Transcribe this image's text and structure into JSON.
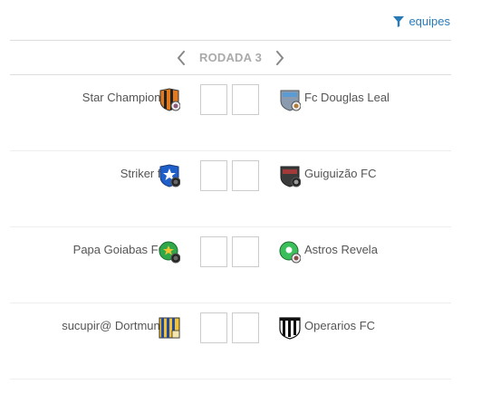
{
  "filter": {
    "label": "equipes",
    "icon": "filter-icon"
  },
  "round": {
    "title": "RODADA 3",
    "prev_icon": "chevron-left-icon",
    "next_icon": "chevron-right-icon"
  },
  "colors": {
    "link": "#2a7ab8",
    "muted": "#aaaaaa",
    "text": "#555555"
  },
  "matches": [
    {
      "home": {
        "name": "Star Champions",
        "crest": "orange-black-crest-icon"
      },
      "away": {
        "name": "Fc Douglas Leal",
        "crest": "blue-grey-crest-icon"
      },
      "home_score": "",
      "away_score": ""
    },
    {
      "home": {
        "name": "Striker fc",
        "crest": "blue-shield-crest-icon"
      },
      "away": {
        "name": "Guiguizão FC",
        "crest": "red-black-crest-icon"
      },
      "home_score": "",
      "away_score": ""
    },
    {
      "home": {
        "name": "Papa Goiabas FC",
        "crest": "green-round-crest-icon"
      },
      "away": {
        "name": "Astros Revela",
        "crest": "green-round-crest-icon"
      },
      "home_score": "",
      "away_score": ""
    },
    {
      "home": {
        "name": "sucupir@ Dortmund",
        "crest": "blue-yellow-striped-crest-icon"
      },
      "away": {
        "name": "Operarios FC",
        "crest": "black-white-striped-crest-icon"
      },
      "home_score": "",
      "away_score": ""
    }
  ]
}
